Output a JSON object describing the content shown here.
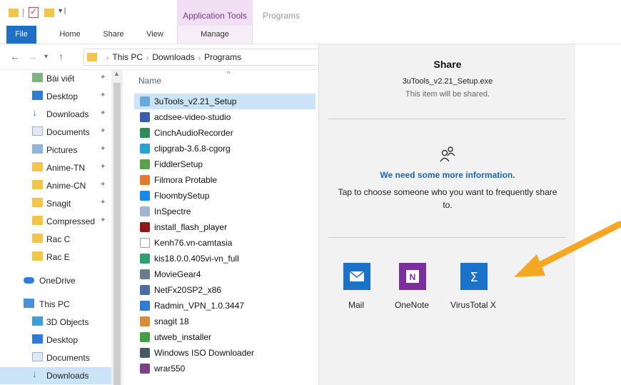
{
  "titlebar": {
    "context_tab": "Application Tools",
    "window_title": "Programs"
  },
  "ribbon": {
    "tabs": [
      "File",
      "Home",
      "Share",
      "View",
      "Manage"
    ]
  },
  "address": {
    "crumbs": [
      "This PC",
      "Downloads",
      "Programs"
    ]
  },
  "navpane": {
    "items": [
      {
        "label": "Bài viết",
        "icon": "article-icon",
        "pinned": true
      },
      {
        "label": "Desktop",
        "icon": "desktop-icon",
        "pinned": true
      },
      {
        "label": "Downloads",
        "icon": "download-arrow-icon",
        "pinned": true
      },
      {
        "label": "Documents",
        "icon": "documents-icon",
        "pinned": true
      },
      {
        "label": "Pictures",
        "icon": "pictures-icon",
        "pinned": true
      },
      {
        "label": "Anime-TN",
        "icon": "folder-icon",
        "pinned": true
      },
      {
        "label": "Anime-CN",
        "icon": "folder-icon",
        "pinned": true
      },
      {
        "label": "Snagit",
        "icon": "folder-icon",
        "pinned": true
      },
      {
        "label": "Compressed",
        "icon": "folder-icon",
        "pinned": true
      },
      {
        "label": "Rac C",
        "icon": "folder-icon",
        "pinned": false
      },
      {
        "label": "Rac E",
        "icon": "folder-icon",
        "pinned": false
      },
      {
        "label": "OneDrive",
        "icon": "onedrive-cloud-icon",
        "pinned": false
      },
      {
        "label": "This PC",
        "icon": "computer-icon",
        "pinned": false
      },
      {
        "label": "3D Objects",
        "icon": "3d-objects-icon",
        "pinned": false
      },
      {
        "label": "Desktop",
        "icon": "desktop-icon",
        "pinned": false
      },
      {
        "label": "Documents",
        "icon": "documents-icon",
        "pinned": false
      },
      {
        "label": "Downloads",
        "icon": "download-arrow-icon",
        "pinned": false
      }
    ]
  },
  "filelist": {
    "column_header": "Name",
    "files": [
      {
        "name": "3uTools_v2.21_Setup",
        "color": "#6aa8e0"
      },
      {
        "name": "acdsee-video-studio",
        "color": "#3b5ea8"
      },
      {
        "name": "CinchAudioRecorder",
        "color": "#2e8b57"
      },
      {
        "name": "clipgrab-3.6.8-cgorg",
        "color": "#29a3d6"
      },
      {
        "name": "FiddlerSetup",
        "color": "#5aa24a"
      },
      {
        "name": "Filmora Protable",
        "color": "#e07a2e"
      },
      {
        "name": "FloombySetup",
        "color": "#1e88e5"
      },
      {
        "name": "InSpectre",
        "color": "#9eb7cf"
      },
      {
        "name": "install_flash_player",
        "color": "#8b1a1a"
      },
      {
        "name": "Kenh76.vn-camtasia",
        "color": "#ffffff"
      },
      {
        "name": "kis18.0.0.405vi-vn_full",
        "color": "#2e9e6a"
      },
      {
        "name": "MovieGear4",
        "color": "#6b7b8c"
      },
      {
        "name": "NetFx20SP2_x86",
        "color": "#4a6fa5"
      },
      {
        "name": "Radmin_VPN_1.0.3447",
        "color": "#2d7dd2"
      },
      {
        "name": "snagit 18",
        "color": "#d98b3a"
      },
      {
        "name": "utweb_installer",
        "color": "#43a047"
      },
      {
        "name": "Windows ISO Downloader",
        "color": "#455a64"
      },
      {
        "name": "wrar550",
        "color": "#7b3f8c"
      }
    ]
  },
  "share": {
    "title": "Share",
    "filename": "3uTools_v2.21_Setup.exe",
    "note": "This item will be shared.",
    "need_info": "We need some more information.",
    "tap_text": "Tap to choose someone who you want to frequently share to.",
    "apps": [
      {
        "label": "Mail",
        "icon": "mail-icon",
        "color": "#1a73c9"
      },
      {
        "label": "OneNote",
        "icon": "onenote-icon",
        "color": "#7b2f9e"
      },
      {
        "label": "VirusTotal X",
        "icon": "sigma-icon",
        "color": "#1a73c9"
      }
    ]
  },
  "colors": {
    "accent": "#1f6fc7",
    "selection": "#cce4f7",
    "context_tab": "#f1e0f4",
    "arrow": "#f5a623"
  }
}
